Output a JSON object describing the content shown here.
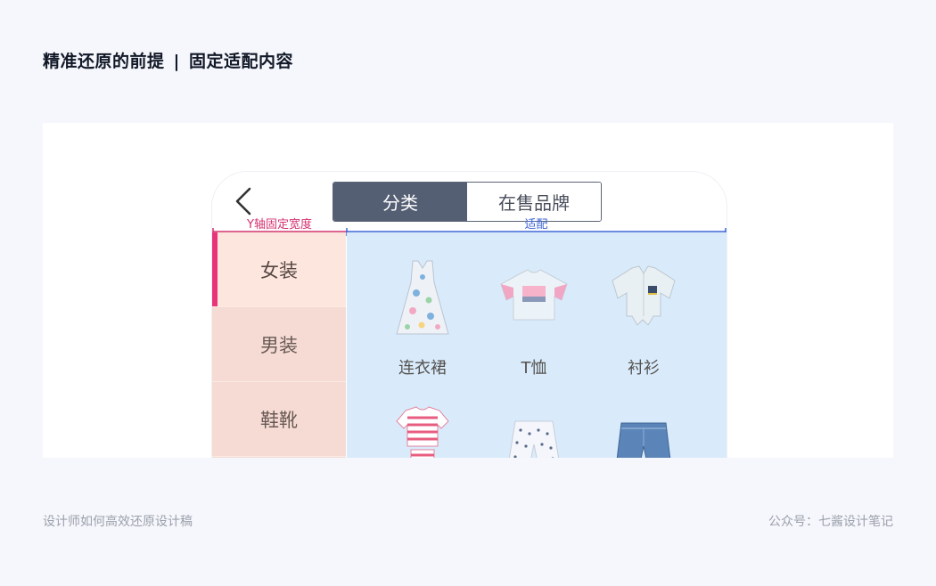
{
  "page": {
    "title_left": "精准还原的前提",
    "title_separator": "|",
    "title_right": "固定适配内容"
  },
  "phone": {
    "tabs": [
      {
        "label": "分类",
        "active": true
      },
      {
        "label": "在售品牌",
        "active": false
      }
    ],
    "annotations": {
      "fixed_width_label": "Y轴固定宽度",
      "fit_label": "适配",
      "fixed_color": "#d4316f",
      "fit_color": "#3a63d6"
    },
    "sidebar": {
      "items": [
        {
          "label": "女装",
          "active": true
        },
        {
          "label": "男装",
          "active": false
        },
        {
          "label": "鞋靴",
          "active": false
        }
      ]
    },
    "products": [
      {
        "label": "连衣裙",
        "icon": "dress-icon"
      },
      {
        "label": "T恤",
        "icon": "tshirt-icon"
      },
      {
        "label": "衬衫",
        "icon": "shirt-icon"
      },
      {
        "label": "",
        "icon": "striped-set-icon"
      },
      {
        "label": "",
        "icon": "shorts-icon"
      },
      {
        "label": "",
        "icon": "denim-shorts-icon"
      }
    ],
    "colors": {
      "sidebar_bg": "#f5dbd3",
      "sidebar_active_bg": "#fde6de",
      "accent": "#e8357a",
      "content_bg": "#d9ebfb",
      "tab_active_bg": "#555f73"
    }
  },
  "footer": {
    "left": "设计师如何高效还原设计稿",
    "right": "公众号：七酱设计笔记"
  }
}
